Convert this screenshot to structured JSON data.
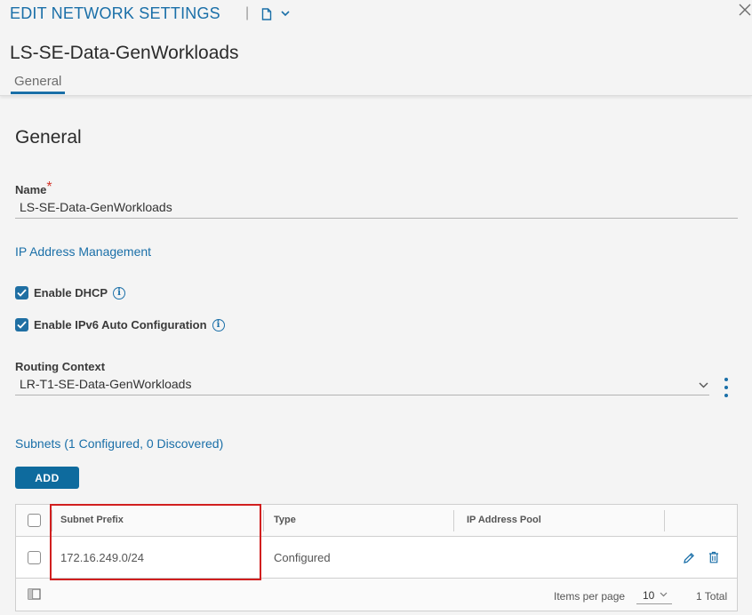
{
  "dialog": {
    "title": "EDIT NETWORK SETTINGS",
    "separator": "|",
    "entity_name": "LS-SE-Data-GenWorkloads",
    "tabs": [
      {
        "label": "General",
        "active": true
      }
    ]
  },
  "general": {
    "heading": "General",
    "name_label": "Name",
    "name_required": "*",
    "name_value": "LS-SE-Data-GenWorkloads",
    "ipam_title": "IP Address Management",
    "enable_dhcp": {
      "label": "Enable DHCP",
      "checked": true
    },
    "enable_ipv6": {
      "label": "Enable IPv6 Auto Configuration",
      "checked": true
    },
    "routing_context_label": "Routing Context",
    "routing_context_value": "LR-T1-SE-Data-GenWorkloads"
  },
  "subnets": {
    "title": "Subnets (1 Configured, 0 Discovered)",
    "add_label": "ADD",
    "columns": [
      "Subnet Prefix",
      "Type",
      "IP Address Pool"
    ],
    "rows": [
      {
        "subnet_prefix": "172.16.249.0/24",
        "type": "Configured",
        "ip_address_pool": ""
      }
    ],
    "footer": {
      "items_per_page_label": "Items per page",
      "items_per_page_value": "10",
      "total": "1 Total"
    }
  },
  "colors": {
    "accent": "#1a6fa8",
    "button": "#0e6b9e",
    "required": "#d4352b",
    "highlight_box": "#d11f1f"
  },
  "icons": [
    "document-icon",
    "chevron-down-icon",
    "close-icon",
    "info-icon",
    "kebab-menu-icon",
    "edit-icon",
    "trash-icon",
    "columns-icon"
  ]
}
